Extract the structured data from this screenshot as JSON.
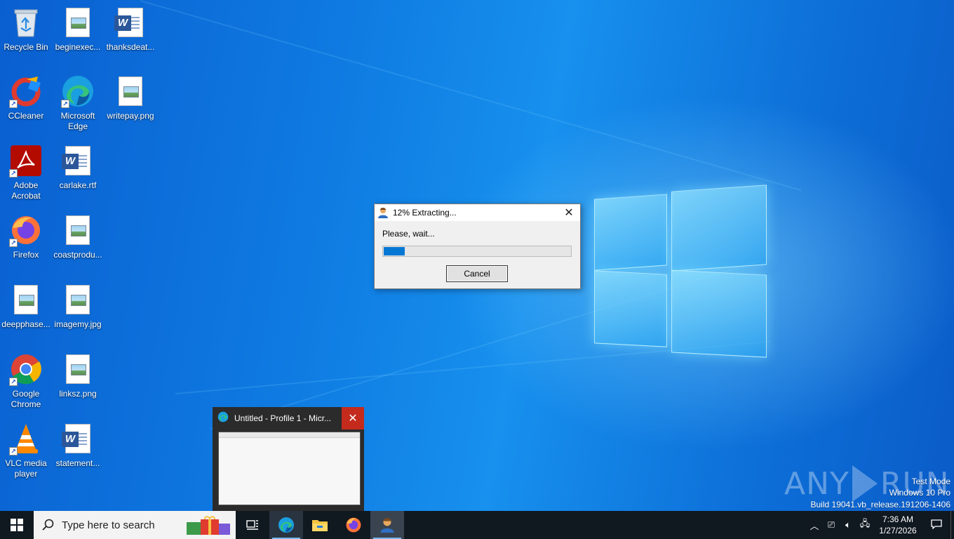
{
  "desktop": {
    "icons": [
      {
        "label": "Recycle Bin"
      },
      {
        "label": "beginexec..."
      },
      {
        "label": "thanksdeat..."
      },
      {
        "label": "CCleaner"
      },
      {
        "label": "Microsoft Edge"
      },
      {
        "label": "writepay.png"
      },
      {
        "label": "Adobe Acrobat"
      },
      {
        "label": "carlake.rtf"
      },
      {
        "label": "Firefox"
      },
      {
        "label": "coastprodu..."
      },
      {
        "label": "deepphase..."
      },
      {
        "label": "imagemy.jpg"
      },
      {
        "label": "Google Chrome"
      },
      {
        "label": "linksz.png"
      },
      {
        "label": "VLC media player"
      },
      {
        "label": "statement..."
      }
    ]
  },
  "dialog": {
    "title": "12% Extracting...",
    "message": "Please, wait...",
    "progress": 0.12,
    "cancel_label": "Cancel",
    "close_glyph": "✕"
  },
  "preview": {
    "title": "Untitled - Profile 1 - Micr...",
    "close_glyph": "✕"
  },
  "watermark": {
    "left": "ANY",
    "right": "RUN"
  },
  "system": {
    "mode": "Test Mode",
    "edition": "Windows 10 Pro",
    "build": "Build 19041.vb_release.191206-1406"
  },
  "taskbar": {
    "search_placeholder": "Type here to search",
    "time": "7:36 AM",
    "date": "1/27/2026"
  },
  "colors": {
    "accent": "#0678d4",
    "taskbar": "#101820",
    "close_red": "#c42b1c"
  }
}
